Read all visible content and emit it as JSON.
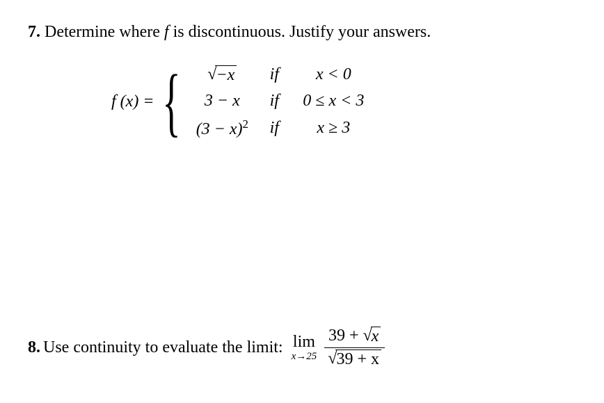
{
  "problem7": {
    "number": "7.",
    "text": "Determine where ",
    "fvar": "f ",
    "text2": "is discontinuous. Justify your answers.",
    "fn_label": "f (x) = ",
    "case1": {
      "sqrt_arg": "−x",
      "if": "if",
      "cond": "x < 0"
    },
    "case2": {
      "expr": "3 − x",
      "if": "if",
      "cond": "0 ≤ x < 3"
    },
    "case3": {
      "expr_base": "(3 − x)",
      "expr_sup": "2",
      "if": "if",
      "cond": "x ≥ 3"
    }
  },
  "problem8": {
    "number": "8.",
    "text": "Use continuity to evaluate the limit:",
    "lim": "lim",
    "lim_sub": "x→25",
    "num_const": "39 + ",
    "num_sqrt_arg": "x",
    "den_sqrt_arg": "39 + x"
  }
}
